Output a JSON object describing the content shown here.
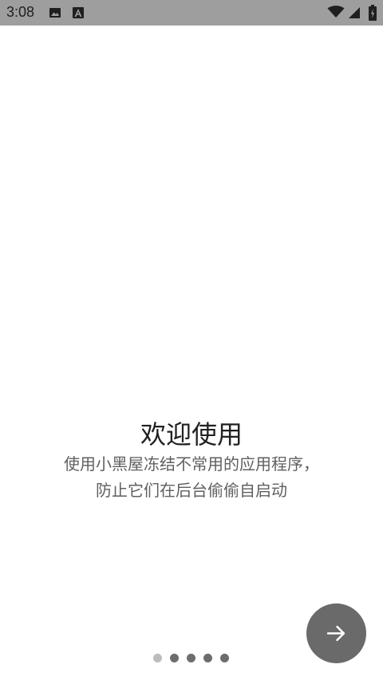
{
  "status_bar": {
    "time": "3:08",
    "icons": [
      "gallery-icon",
      "a-app-icon",
      "wifi-icon",
      "signal-icon",
      "battery-icon"
    ],
    "background": "#9e9e9e"
  },
  "onboarding": {
    "title": "欢迎使用",
    "description_line1": "使用小黑屋冻结不常用的应用程序，",
    "description_line2": "防止它们在后台偷偷自启动",
    "page_indicator": {
      "total": 5,
      "current": 1
    },
    "next_button_icon": "arrow-right-icon",
    "accent": "#6a6a6a"
  }
}
